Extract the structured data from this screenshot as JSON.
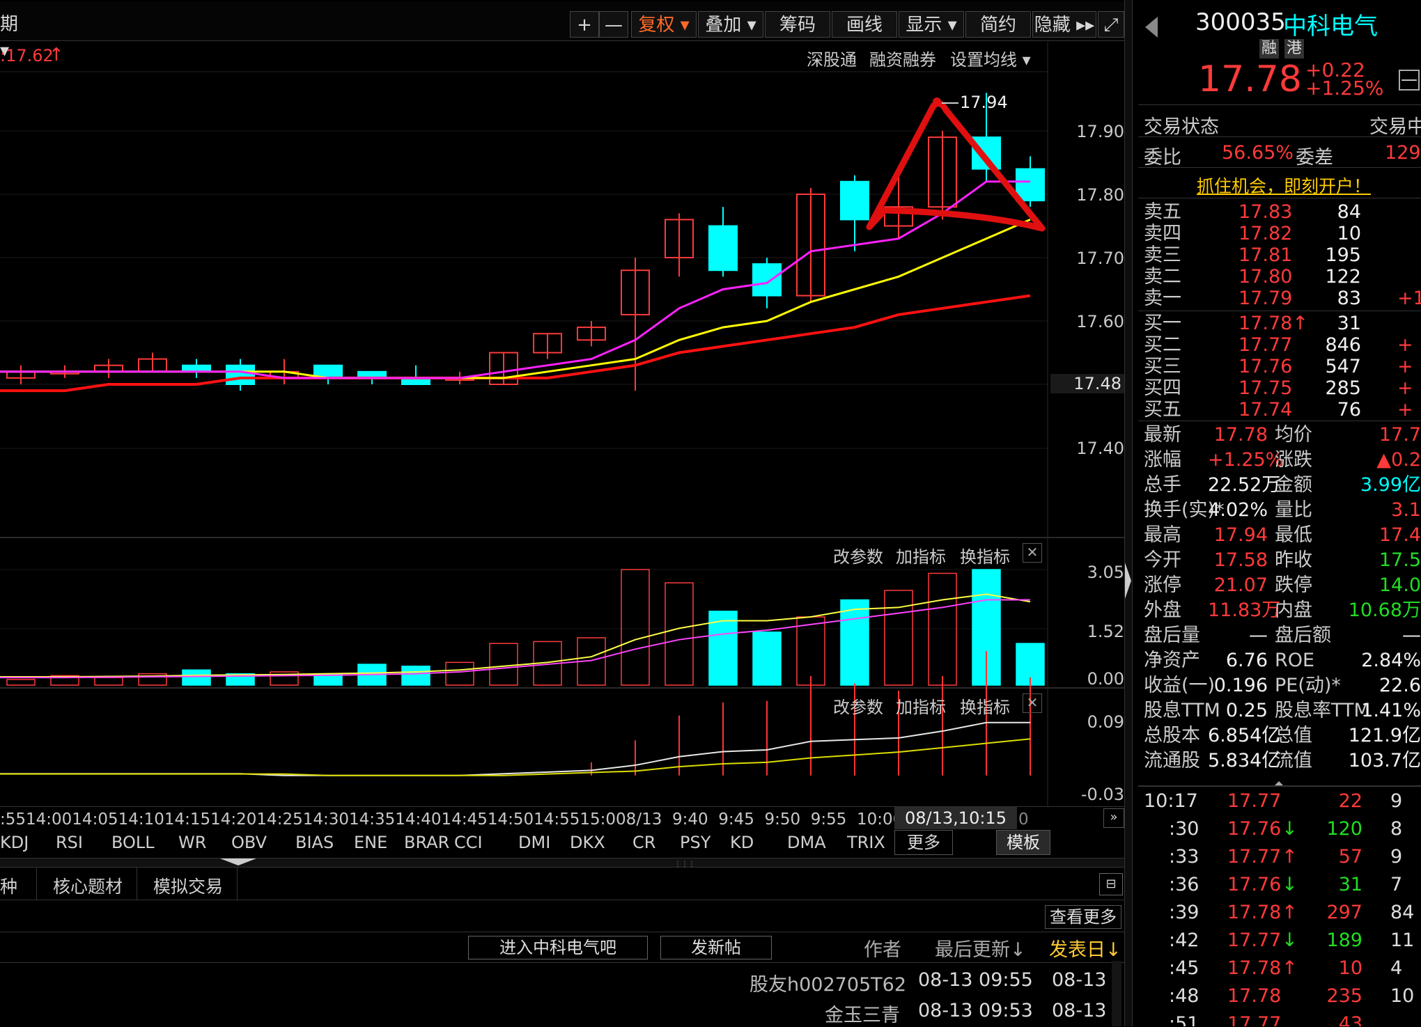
{
  "toolbar": {
    "period_label": "期",
    "zoom_in": "+",
    "zoom_out": "—",
    "fuquan": "复权",
    "diejia": "叠加",
    "chouma": "筹码",
    "huaxian": "画线",
    "xianshi": "显示",
    "jianyue": "简约",
    "yincang": "隐藏",
    "fullscreen_icon": "fullscreen-icon"
  },
  "chart": {
    "price_tag": ":17.62",
    "links": {
      "sgt": "深股通",
      "rzrq": "融资融券",
      "szjx": "设置均线"
    },
    "high_label": "17.94",
    "current_price_label": "17.48",
    "price_axis": [
      "17.90",
      "17.80",
      "17.70",
      "17.60",
      "17.48",
      "17.40"
    ],
    "vol_axis": [
      "3.05",
      "1.52",
      "0.00"
    ],
    "ind_axis": [
      "0.09",
      "-0.03"
    ],
    "panel_btns": {
      "gai": "改参数",
      "jia": "加指标",
      "huan": "换指标"
    },
    "time_axis_text": ":5514:0014:0514:1014:1514:2014:2514:3014:3514:4014:4514:5014:5515:008/13  9:40  9:45  9:50  9:55  10:0010:05",
    "time_tooltip": "08/13,10:15",
    "time_tail": "0",
    "colors": {
      "up": "#ff3a3a",
      "down": "#00ffff",
      "ma5": "#ff22ff",
      "ma10": "#ffff00",
      "ma20": "#ff1111",
      "triangle": "#e01010"
    },
    "candles": [
      {
        "o": 17.49,
        "c": 17.5,
        "h": 17.51,
        "l": 17.48
      },
      {
        "o": 17.5,
        "c": 17.5,
        "h": 17.51,
        "l": 17.49
      },
      {
        "o": 17.5,
        "c": 17.51,
        "h": 17.52,
        "l": 17.49
      },
      {
        "o": 17.5,
        "c": 17.52,
        "h": 17.53,
        "l": 17.5
      },
      {
        "o": 17.51,
        "c": 17.5,
        "h": 17.52,
        "l": 17.49
      },
      {
        "o": 17.51,
        "c": 17.48,
        "h": 17.52,
        "l": 17.47
      },
      {
        "o": 17.49,
        "c": 17.5,
        "h": 17.52,
        "l": 17.48
      },
      {
        "o": 17.51,
        "c": 17.49,
        "h": 17.51,
        "l": 17.48
      },
      {
        "o": 17.5,
        "c": 17.49,
        "h": 17.5,
        "l": 17.48
      },
      {
        "o": 17.49,
        "c": 17.48,
        "h": 17.51,
        "l": 17.48
      },
      {
        "o": 17.49,
        "c": 17.49,
        "h": 17.5,
        "l": 17.48
      },
      {
        "o": 17.48,
        "c": 17.53,
        "h": 17.53,
        "l": 17.48
      },
      {
        "o": 17.53,
        "c": 17.56,
        "h": 17.56,
        "l": 17.52
      },
      {
        "o": 17.55,
        "c": 17.57,
        "h": 17.58,
        "l": 17.54
      },
      {
        "o": 17.59,
        "c": 17.66,
        "h": 17.68,
        "l": 17.47
      },
      {
        "o": 17.68,
        "c": 17.74,
        "h": 17.75,
        "l": 17.65
      },
      {
        "o": 17.73,
        "c": 17.66,
        "h": 17.76,
        "l": 17.65
      },
      {
        "o": 17.67,
        "c": 17.62,
        "h": 17.68,
        "l": 17.6
      },
      {
        "o": 17.62,
        "c": 17.78,
        "h": 17.79,
        "l": 17.61
      },
      {
        "o": 17.8,
        "c": 17.74,
        "h": 17.81,
        "l": 17.69
      },
      {
        "o": 17.73,
        "c": 17.76,
        "h": 17.81,
        "l": 17.71
      },
      {
        "o": 17.76,
        "c": 17.87,
        "h": 17.88,
        "l": 17.74
      },
      {
        "o": 17.87,
        "c": 17.82,
        "h": 17.94,
        "l": 17.8
      },
      {
        "o": 17.82,
        "c": 17.77,
        "h": 17.84,
        "l": 17.76
      }
    ],
    "ma5": [
      17.5,
      17.5,
      17.5,
      17.5,
      17.5,
      17.5,
      17.49,
      17.49,
      17.49,
      17.49,
      17.49,
      17.5,
      17.51,
      17.52,
      17.55,
      17.6,
      17.63,
      17.64,
      17.69,
      17.7,
      17.71,
      17.75,
      17.8,
      17.8
    ],
    "ma10": [
      17.5,
      17.5,
      17.5,
      17.5,
      17.5,
      17.5,
      17.5,
      17.49,
      17.49,
      17.49,
      17.49,
      17.49,
      17.5,
      17.51,
      17.52,
      17.55,
      17.57,
      17.58,
      17.61,
      17.63,
      17.65,
      17.68,
      17.71,
      17.74
    ],
    "ma20": [
      17.47,
      17.47,
      17.48,
      17.48,
      17.48,
      17.49,
      17.49,
      17.49,
      17.49,
      17.49,
      17.49,
      17.49,
      17.49,
      17.5,
      17.51,
      17.53,
      17.54,
      17.55,
      17.56,
      17.57,
      17.59,
      17.6,
      17.61,
      17.62
    ],
    "volumes": [
      0.15,
      0.25,
      0.2,
      0.3,
      0.4,
      0.3,
      0.35,
      0.3,
      0.55,
      0.5,
      0.6,
      1.1,
      1.15,
      1.25,
      3.05,
      2.7,
      1.95,
      1.4,
      1.8,
      2.25,
      2.5,
      2.95,
      3.05,
      1.1
    ],
    "vol_ma1": [
      0.22,
      0.22,
      0.23,
      0.24,
      0.26,
      0.27,
      0.28,
      0.3,
      0.32,
      0.35,
      0.4,
      0.5,
      0.6,
      0.75,
      1.2,
      1.5,
      1.7,
      1.7,
      1.8,
      2.0,
      2.05,
      2.25,
      2.4,
      2.2
    ],
    "vol_ma2": [
      0.2,
      0.2,
      0.21,
      0.22,
      0.23,
      0.24,
      0.25,
      0.26,
      0.28,
      0.3,
      0.35,
      0.45,
      0.55,
      0.65,
      0.95,
      1.2,
      1.35,
      1.45,
      1.6,
      1.75,
      1.9,
      2.05,
      2.25,
      2.25
    ]
  },
  "indicators": [
    "KDJ",
    "RSI",
    "BOLL",
    "WR",
    "OBV",
    "BIAS",
    "ENE",
    "BRAR",
    "CCI",
    "DMI",
    "DKX",
    "CR",
    "PSY",
    "KD",
    "DMA",
    "TRIX"
  ],
  "ind_more": "更多",
  "ind_tpl": "模板",
  "bottom": {
    "tabs": [
      "种",
      "核心题材",
      "模拟交易"
    ],
    "more": "查看更多",
    "btn_bar": "进入中科电气吧",
    "btn_post": "发新帖",
    "col_author": "作者",
    "col_update": "最后更新↓",
    "col_date": "发表日↓",
    "posts": [
      {
        "author": "股友h002705T62",
        "update": "08-13 09:55",
        "date": "08-13"
      },
      {
        "author": "金玉三青",
        "update": "08-13 09:53",
        "date": "08-13"
      }
    ]
  },
  "quote": {
    "code": "300035",
    "name": "中科电气",
    "tags": [
      "融",
      "港"
    ],
    "price": "17.78",
    "change": "+0.22",
    "pct": "+1.25%",
    "status_label": "交易状态",
    "status_value": "交易中",
    "weibi_label": "委比",
    "weibi": "56.65%",
    "weicha_label": "委差",
    "weicha": "129",
    "promo": "抓住机会，即刻开户！",
    "asks": [
      {
        "l": "卖五",
        "p": "17.83",
        "v": "84",
        "e": ""
      },
      {
        "l": "卖四",
        "p": "17.82",
        "v": "10",
        "e": ""
      },
      {
        "l": "卖三",
        "p": "17.81",
        "v": "195",
        "e": ""
      },
      {
        "l": "卖二",
        "p": "17.80",
        "v": "122",
        "e": ""
      },
      {
        "l": "卖一",
        "p": "17.79",
        "v": "83",
        "e": "+1"
      }
    ],
    "bids": [
      {
        "l": "买一",
        "p": "17.78↑",
        "v": "31",
        "e": ""
      },
      {
        "l": "买二",
        "p": "17.77",
        "v": "846",
        "e": "+"
      },
      {
        "l": "买三",
        "p": "17.76",
        "v": "547",
        "e": "+"
      },
      {
        "l": "买四",
        "p": "17.75",
        "v": "285",
        "e": "+"
      },
      {
        "l": "买五",
        "p": "17.74",
        "v": "76",
        "e": "+"
      }
    ],
    "fields": [
      {
        "l1": "最新",
        "v1": "17.78",
        "l2": "均价",
        "v2": "17.7"
      },
      {
        "l1": "涨幅",
        "v1": "+1.25%",
        "l2": "涨跌",
        "v2": "▲0.2"
      },
      {
        "l1": "总手",
        "v1": "22.52万",
        "l2": "金额",
        "v2": "3.99亿"
      },
      {
        "l1": "换手(实)*",
        "v1": "4.02%",
        "l2": "量比",
        "v2": "3.1"
      },
      {
        "l1": "最高",
        "v1": "17.94",
        "l2": "最低",
        "v2": "17.4"
      },
      {
        "l1": "今开",
        "v1": "17.58",
        "l2": "昨收",
        "v2": "17.5"
      },
      {
        "l1": "涨停",
        "v1": "21.07",
        "l2": "跌停",
        "v2": "14.0"
      },
      {
        "l1": "外盘",
        "v1": "11.83万",
        "l2": "内盘",
        "v2": "10.68万"
      },
      {
        "l1": "盘后量",
        "v1": "—",
        "l2": "盘后额",
        "v2": "—"
      },
      {
        "l1": "净资产",
        "v1": "6.76",
        "l2": "ROE",
        "v2": "2.84%"
      },
      {
        "l1": "收益(一)",
        "v1": "0.196",
        "l2": "PE(动)*",
        "v2": "22.6"
      },
      {
        "l1": "股息TTM",
        "v1": "0.25",
        "l2": "股息率TTM",
        "v2": "1.41%"
      },
      {
        "l1": "总股本",
        "v1": "6.854亿",
        "l2": "总值",
        "v2": "121.9亿"
      },
      {
        "l1": "流通股",
        "v1": "5.834亿",
        "l2": "流值",
        "v2": "103.7亿"
      }
    ],
    "ticks": [
      {
        "t": "10:17",
        "p": "17.77",
        "a": "",
        "v": "22",
        "e": "9"
      },
      {
        "t": ":30",
        "p": "17.76",
        "a": "↓",
        "v": "120",
        "e": "8"
      },
      {
        "t": ":33",
        "p": "17.77",
        "a": "↑",
        "v": "57",
        "e": "9"
      },
      {
        "t": ":36",
        "p": "17.76",
        "a": "↓",
        "v": "31",
        "e": "7"
      },
      {
        "t": ":39",
        "p": "17.78",
        "a": "↑",
        "v": "297",
        "e": "84"
      },
      {
        "t": ":42",
        "p": "17.77",
        "a": "↓",
        "v": "189",
        "e": "11"
      },
      {
        "t": ":45",
        "p": "17.78",
        "a": "↑",
        "v": "10",
        "e": "4"
      },
      {
        "t": ":48",
        "p": "17.78",
        "a": "",
        "v": "235",
        "e": "10"
      },
      {
        "t": ":51",
        "p": "17.77",
        "a": "",
        "v": "43",
        "e": ""
      }
    ]
  }
}
